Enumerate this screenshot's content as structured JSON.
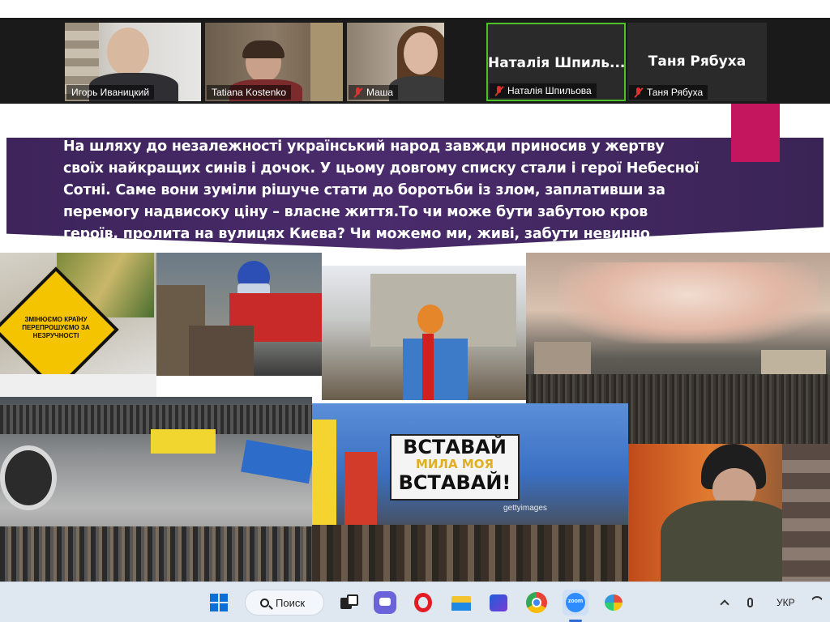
{
  "participants": [
    {
      "name": "Игорь Иваницкий",
      "muted": false,
      "has_video": true
    },
    {
      "name": "Tatiana Kostenko",
      "muted": false,
      "has_video": true
    },
    {
      "name": "Маша",
      "muted": true,
      "has_video": true
    },
    {
      "name": "Наталія Шпильова",
      "display_name": "Наталія Шпиль...",
      "muted": true,
      "has_video": false,
      "active_speaker": true
    },
    {
      "name": "Таня Рябуха",
      "display_name": "Таня Рябуха",
      "muted": true,
      "has_video": false
    }
  ],
  "slide": {
    "text": "На шляху до незалежності український народ завжди приносив у жертву своїх найкращих синів і дочок. У цьому довгому списку стали і герої Небесної Сотні. Саме вони зуміли рішуче стати до боротьби із злом, заплативши за перемогу надвисоку ціну – власне життя.То чи може бути забутою кров героїв, пролита на вулицях Києва? Чи можемо ми, живі, забути невинно убієнних? Можлива лише одна відповідь – Ні!",
    "sign_text": "ЗМІНЮЄМО КРАЇНУ ПЕРЕПРОШУЄМО ЗА НЕЗРУЧНОСТІ",
    "poster_line1": "ВСТАВАЙ",
    "poster_line2": "МИЛА МОЯ",
    "poster_line3": "ВСТАВАЙ!",
    "watermark": "gettyimages"
  },
  "taskbar": {
    "search_label": "Поиск",
    "zoom_label": "zoom",
    "language": "УКР",
    "apps": [
      "windows-start",
      "search",
      "task-view",
      "teams-chat",
      "opera",
      "file-explorer",
      "app-store",
      "chrome",
      "zoom",
      "paint"
    ]
  },
  "colors": {
    "banner": "#3d245a",
    "accent_magenta": "#c4155f",
    "active_speaker_border": "#4ec127",
    "muted_icon": "#e02f2f"
  }
}
